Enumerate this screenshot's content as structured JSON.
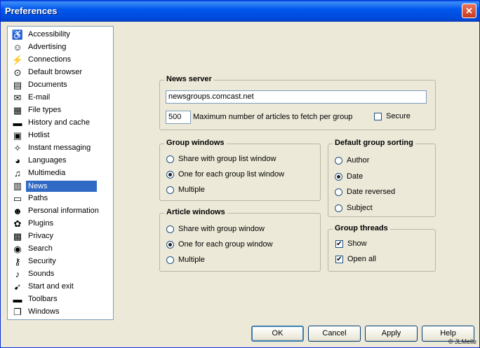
{
  "window": {
    "title": "Preferences"
  },
  "sidebar": {
    "items": [
      {
        "label": "Accessibility",
        "icon": "wheelchair-icon",
        "glyph": "♿"
      },
      {
        "label": "Advertising",
        "icon": "smiley-icon",
        "glyph": "☺"
      },
      {
        "label": "Connections",
        "icon": "plug-icon",
        "glyph": "⚡"
      },
      {
        "label": "Default browser",
        "icon": "opera-icon",
        "glyph": "⊙"
      },
      {
        "label": "Documents",
        "icon": "document-icon",
        "glyph": "▤"
      },
      {
        "label": "E-mail",
        "icon": "envelope-icon",
        "glyph": "✉"
      },
      {
        "label": "File types",
        "icon": "files-icon",
        "glyph": "▦"
      },
      {
        "label": "History and cache",
        "icon": "disk-icon",
        "glyph": "▬"
      },
      {
        "label": "Hotlist",
        "icon": "hotlist-icon",
        "glyph": "▣"
      },
      {
        "label": "Instant messaging",
        "icon": "messaging-icon",
        "glyph": "✧"
      },
      {
        "label": "Languages",
        "icon": "languages-icon",
        "glyph": "◕"
      },
      {
        "label": "Multimedia",
        "icon": "multimedia-icon",
        "glyph": "♫"
      },
      {
        "label": "News",
        "icon": "news-icon",
        "glyph": "▥"
      },
      {
        "label": "Paths",
        "icon": "folder-icon",
        "glyph": "▭"
      },
      {
        "label": "Personal information",
        "icon": "person-icon",
        "glyph": "☻"
      },
      {
        "label": "Plugins",
        "icon": "plugin-icon",
        "glyph": "✿"
      },
      {
        "label": "Privacy",
        "icon": "privacy-icon",
        "glyph": "▩"
      },
      {
        "label": "Search",
        "icon": "globe-search-icon",
        "glyph": "◉"
      },
      {
        "label": "Security",
        "icon": "key-icon",
        "glyph": "⚷"
      },
      {
        "label": "Sounds",
        "icon": "speaker-icon",
        "glyph": "♪"
      },
      {
        "label": "Start and exit",
        "icon": "start-exit-icon",
        "glyph": "➹"
      },
      {
        "label": "Toolbars",
        "icon": "toolbar-icon",
        "glyph": "▬"
      },
      {
        "label": "Windows",
        "icon": "windows-icon",
        "glyph": "❐"
      }
    ],
    "selected_index": 12
  },
  "news_server": {
    "title": "News server",
    "server": "newsgroups.comcast.net",
    "max_articles": "500",
    "max_articles_label": "Maximum number of articles to fetch per group",
    "secure_label": "Secure",
    "secure_checked": false
  },
  "group_windows": {
    "title": "Group windows",
    "options": [
      "Share with group list window",
      "One for each group list window",
      "Multiple"
    ],
    "selected": 1
  },
  "article_windows": {
    "title": "Article windows",
    "options": [
      "Share with group window",
      "One for each group window",
      "Multiple"
    ],
    "selected": 1
  },
  "default_sorting": {
    "title": "Default group sorting",
    "options": [
      "Author",
      "Date",
      "Date reversed",
      "Subject"
    ],
    "selected": 1
  },
  "group_threads": {
    "title": "Group threads",
    "show_label": "Show",
    "show_checked": true,
    "open_all_label": "Open all",
    "open_all_checked": true
  },
  "buttons": {
    "ok": "OK",
    "cancel": "Cancel",
    "apply": "Apply",
    "help": "Help"
  },
  "copyright": "© JLMelle"
}
